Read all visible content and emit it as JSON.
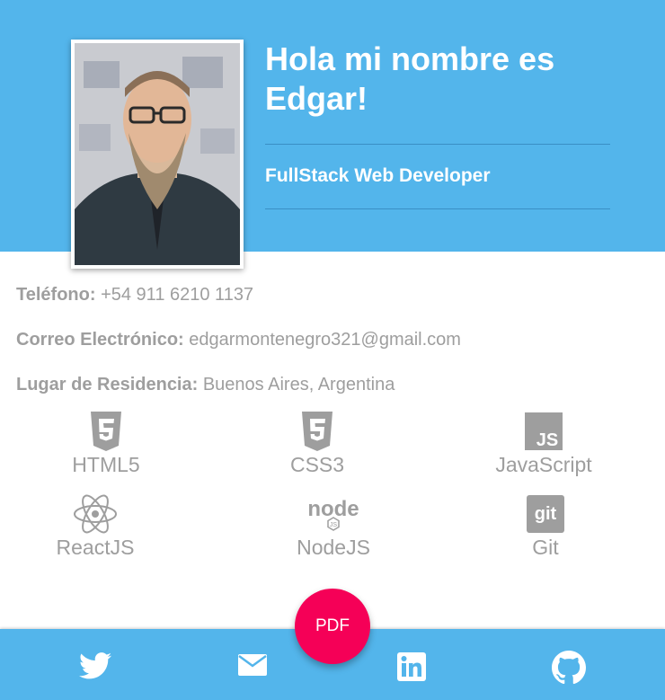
{
  "header": {
    "greeting": "Hola mi nombre es Edgar!",
    "role": "FullStack Web Developer"
  },
  "contact": {
    "phone_label": "Teléfono:",
    "phone_value": "+54 911 6210 1137",
    "email_label": "Correo Electrónico:",
    "email_value": "edgarmontenegro321@gmail.com",
    "location_label": "Lugar de Residencia:",
    "location_value": "Buenos Aires, Argentina"
  },
  "skills": [
    {
      "label": "HTML5",
      "icon": "html5-icon"
    },
    {
      "label": "CSS3",
      "icon": "css3-icon"
    },
    {
      "label": "JavaScript",
      "icon": "javascript-icon"
    },
    {
      "label": "ReactJS",
      "icon": "react-icon"
    },
    {
      "label": "NodeJS",
      "icon": "nodejs-icon"
    },
    {
      "label": "Git",
      "icon": "git-icon"
    }
  ],
  "pdf_button": "PDF",
  "footer": {
    "icons": [
      "twitter-icon",
      "mail-icon",
      "linkedin-icon",
      "github-icon"
    ]
  },
  "colors": {
    "primary": "#53b5eb",
    "accent": "#f50057",
    "text_gray": "#9e9e9e"
  }
}
